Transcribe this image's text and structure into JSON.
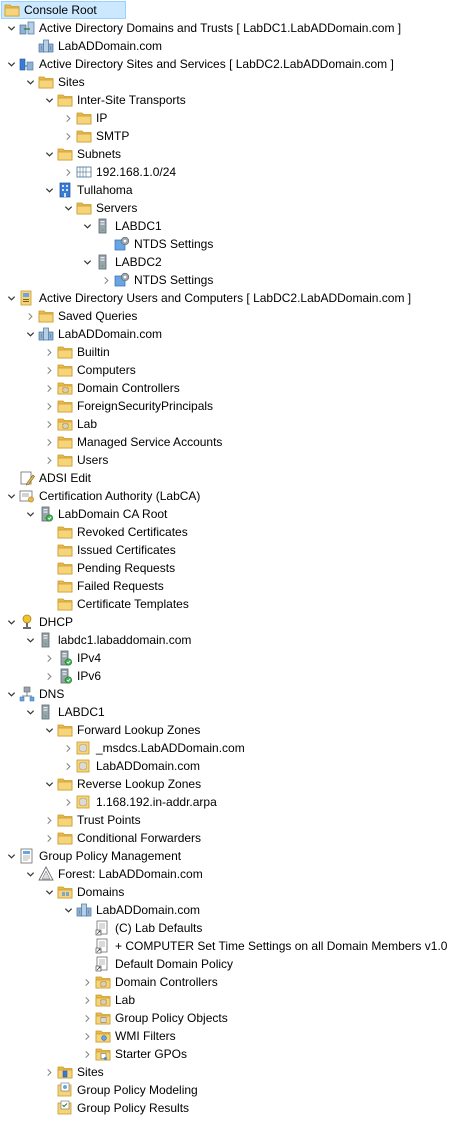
{
  "tree": [
    {
      "label": "Console Root",
      "depth": 0,
      "tw": "none",
      "icon": "folder-icon",
      "selected": true
    },
    {
      "label": "Active Directory Domains and Trusts [ LabDC1.LabADDomain.com ]",
      "depth": 0,
      "tw": "expanded",
      "icon": "domains-trusts-icon"
    },
    {
      "label": "LabADDomain.com",
      "depth": 1,
      "tw": "none",
      "icon": "domain-icon"
    },
    {
      "label": "Active Directory Sites and Services [ LabDC2.LabADDomain.com ]",
      "depth": 0,
      "tw": "expanded",
      "icon": "sites-services-icon"
    },
    {
      "label": "Sites",
      "depth": 1,
      "tw": "expanded",
      "icon": "folder-icon"
    },
    {
      "label": "Inter-Site Transports",
      "depth": 2,
      "tw": "expanded",
      "icon": "folder-icon"
    },
    {
      "label": "IP",
      "depth": 3,
      "tw": "collapsed",
      "icon": "folder-icon"
    },
    {
      "label": "SMTP",
      "depth": 3,
      "tw": "collapsed",
      "icon": "folder-icon"
    },
    {
      "label": "Subnets",
      "depth": 2,
      "tw": "expanded",
      "icon": "folder-icon"
    },
    {
      "label": "192.168.1.0/24",
      "depth": 3,
      "tw": "collapsed",
      "icon": "subnet-icon"
    },
    {
      "label": "Tullahoma",
      "depth": 2,
      "tw": "expanded",
      "icon": "site-icon"
    },
    {
      "label": "Servers",
      "depth": 3,
      "tw": "expanded",
      "icon": "folder-icon"
    },
    {
      "label": "LABDC1",
      "depth": 4,
      "tw": "expanded",
      "icon": "server-icon"
    },
    {
      "label": "NTDS Settings",
      "depth": 5,
      "tw": "none",
      "icon": "ntds-settings-icon"
    },
    {
      "label": "LABDC2",
      "depth": 4,
      "tw": "expanded",
      "icon": "server-icon"
    },
    {
      "label": "NTDS Settings",
      "depth": 5,
      "tw": "collapsed",
      "icon": "ntds-settings-icon"
    },
    {
      "label": "Active Directory Users and Computers [ LabDC2.LabADDomain.com ]",
      "depth": 0,
      "tw": "expanded",
      "icon": "users-computers-icon"
    },
    {
      "label": "Saved Queries",
      "depth": 1,
      "tw": "collapsed",
      "icon": "folder-icon"
    },
    {
      "label": "LabADDomain.com",
      "depth": 1,
      "tw": "expanded",
      "icon": "domain-icon"
    },
    {
      "label": "Builtin",
      "depth": 2,
      "tw": "collapsed",
      "icon": "folder-icon"
    },
    {
      "label": "Computers",
      "depth": 2,
      "tw": "collapsed",
      "icon": "folder-icon"
    },
    {
      "label": "Domain Controllers",
      "depth": 2,
      "tw": "collapsed",
      "icon": "ou-folder-icon"
    },
    {
      "label": "ForeignSecurityPrincipals",
      "depth": 2,
      "tw": "collapsed",
      "icon": "folder-icon"
    },
    {
      "label": "Lab",
      "depth": 2,
      "tw": "collapsed",
      "icon": "ou-folder-icon"
    },
    {
      "label": "Managed Service Accounts",
      "depth": 2,
      "tw": "collapsed",
      "icon": "folder-icon"
    },
    {
      "label": "Users",
      "depth": 2,
      "tw": "collapsed",
      "icon": "folder-icon"
    },
    {
      "label": "ADSI Edit",
      "depth": 0,
      "tw": "none",
      "icon": "adsi-edit-icon"
    },
    {
      "label": "Certification Authority (LabCA)",
      "depth": 0,
      "tw": "expanded",
      "icon": "certification-authority-icon"
    },
    {
      "label": "LabDomain CA Root",
      "depth": 1,
      "tw": "expanded",
      "icon": "ca-server-icon"
    },
    {
      "label": "Revoked Certificates",
      "depth": 2,
      "tw": "none",
      "icon": "folder-icon"
    },
    {
      "label": "Issued Certificates",
      "depth": 2,
      "tw": "none",
      "icon": "folder-icon"
    },
    {
      "label": "Pending Requests",
      "depth": 2,
      "tw": "none",
      "icon": "folder-icon"
    },
    {
      "label": "Failed Requests",
      "depth": 2,
      "tw": "none",
      "icon": "folder-icon"
    },
    {
      "label": "Certificate Templates",
      "depth": 2,
      "tw": "none",
      "icon": "folder-icon"
    },
    {
      "label": "DHCP",
      "depth": 0,
      "tw": "expanded",
      "icon": "dhcp-icon"
    },
    {
      "label": "labdc1.labaddomain.com",
      "depth": 1,
      "tw": "expanded",
      "icon": "server-icon"
    },
    {
      "label": "IPv4",
      "depth": 2,
      "tw": "collapsed",
      "icon": "ipv4-icon"
    },
    {
      "label": "IPv6",
      "depth": 2,
      "tw": "collapsed",
      "icon": "ipv6-icon"
    },
    {
      "label": "DNS",
      "depth": 0,
      "tw": "expanded",
      "icon": "dns-icon"
    },
    {
      "label": "LABDC1",
      "depth": 1,
      "tw": "expanded",
      "icon": "server-icon"
    },
    {
      "label": "Forward Lookup Zones",
      "depth": 2,
      "tw": "expanded",
      "icon": "folder-icon"
    },
    {
      "label": "_msdcs.LabADDomain.com",
      "depth": 3,
      "tw": "collapsed",
      "icon": "zone-icon"
    },
    {
      "label": "LabADDomain.com",
      "depth": 3,
      "tw": "collapsed",
      "icon": "zone-icon"
    },
    {
      "label": "Reverse Lookup Zones",
      "depth": 2,
      "tw": "expanded",
      "icon": "folder-icon"
    },
    {
      "label": "1.168.192.in-addr.arpa",
      "depth": 3,
      "tw": "collapsed",
      "icon": "zone-icon"
    },
    {
      "label": "Trust Points",
      "depth": 2,
      "tw": "collapsed",
      "icon": "folder-icon"
    },
    {
      "label": "Conditional Forwarders",
      "depth": 2,
      "tw": "collapsed",
      "icon": "folder-icon"
    },
    {
      "label": "Group Policy Management",
      "depth": 0,
      "tw": "expanded",
      "icon": "gpm-icon"
    },
    {
      "label": "Forest: LabADDomain.com",
      "depth": 1,
      "tw": "expanded",
      "icon": "forest-icon"
    },
    {
      "label": "Domains",
      "depth": 2,
      "tw": "expanded",
      "icon": "domains-folder-icon"
    },
    {
      "label": "LabADDomain.com",
      "depth": 3,
      "tw": "expanded",
      "icon": "domain-icon"
    },
    {
      "label": "(C) Lab Defaults",
      "depth": 4,
      "tw": "none",
      "icon": "gpo-link-icon"
    },
    {
      "label": "+ COMPUTER Set Time Settings on all Domain Members v1.0",
      "depth": 4,
      "tw": "none",
      "icon": "gpo-link-icon"
    },
    {
      "label": "Default Domain Policy",
      "depth": 4,
      "tw": "none",
      "icon": "gpo-link-icon"
    },
    {
      "label": "Domain Controllers",
      "depth": 4,
      "tw": "collapsed",
      "icon": "ou-folder-icon"
    },
    {
      "label": "Lab",
      "depth": 4,
      "tw": "collapsed",
      "icon": "ou-folder-icon"
    },
    {
      "label": "Group Policy Objects",
      "depth": 4,
      "tw": "collapsed",
      "icon": "gpo-folder-icon"
    },
    {
      "label": "WMI Filters",
      "depth": 4,
      "tw": "collapsed",
      "icon": "wmi-folder-icon"
    },
    {
      "label": "Starter GPOs",
      "depth": 4,
      "tw": "collapsed",
      "icon": "starter-gpo-folder-icon"
    },
    {
      "label": "Sites",
      "depth": 2,
      "tw": "collapsed",
      "icon": "sites-folder-icon"
    },
    {
      "label": "Group Policy Modeling",
      "depth": 2,
      "tw": "none",
      "icon": "gp-modeling-icon"
    },
    {
      "label": "Group Policy Results",
      "depth": 2,
      "tw": "none",
      "icon": "gp-results-icon"
    }
  ],
  "colors": {
    "selection_bg": "#cce8ff",
    "selection_border": "#99d1ff",
    "folder": "#e8b94a",
    "folder_dark": "#c99a2e"
  }
}
